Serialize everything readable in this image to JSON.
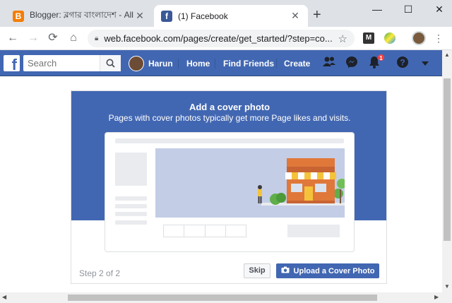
{
  "browser": {
    "tabs": [
      {
        "title": "Blogger: ব্লগার বাংলাদেশ - All pos",
        "favicon": "blogger-icon",
        "active": false
      },
      {
        "title": "(1) Facebook",
        "favicon": "facebook-icon",
        "active": true
      }
    ],
    "close_glyph": "✕",
    "new_tab_glyph": "+",
    "window_controls": {
      "minimize": "—",
      "maximize": "☐",
      "close": "✕"
    },
    "url": "web.facebook.com/pages/create/get_started/?step=co..."
  },
  "facebook": {
    "search_placeholder": "Search",
    "user_name": "Harun",
    "nav": {
      "home": "Home",
      "find_friends": "Find Friends",
      "create": "Create"
    },
    "notification_count": "1",
    "brand_color": "#4267b2"
  },
  "card": {
    "title": "Add a cover photo",
    "subtitle": "Pages with cover photos typically get more Page likes and visits.",
    "step": "Step 2 of 2",
    "skip_label": "Skip",
    "upload_label": "Upload a Cover Photo"
  }
}
